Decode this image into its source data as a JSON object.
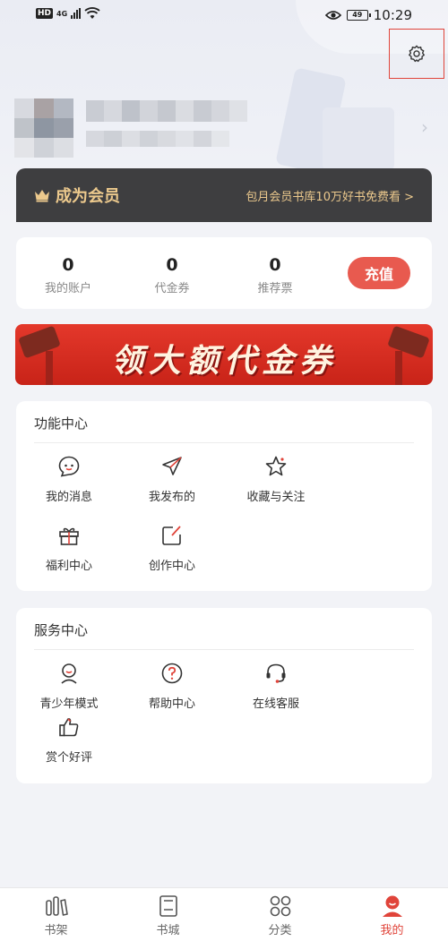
{
  "status_bar": {
    "hd": "HD",
    "network": "4G",
    "battery": "49",
    "time": "10:29"
  },
  "vip": {
    "title": "成为会员",
    "promo": "包月会员书库10万好书免费看 >"
  },
  "account": {
    "stats": [
      {
        "value": "0",
        "label": "我的账户"
      },
      {
        "value": "0",
        "label": "代金券"
      },
      {
        "value": "0",
        "label": "推荐票"
      }
    ],
    "recharge_label": "充值"
  },
  "banner": {
    "text": "领大额代金券"
  },
  "function_center": {
    "title": "功能中心",
    "items": [
      {
        "label": "我的消息",
        "icon": "chat-bubble-icon"
      },
      {
        "label": "我发布的",
        "icon": "paper-plane-icon"
      },
      {
        "label": "收藏与关注",
        "icon": "star-icon"
      },
      {
        "label": "福利中心",
        "icon": "gift-icon"
      },
      {
        "label": "创作中心",
        "icon": "edit-icon"
      }
    ]
  },
  "service_center": {
    "title": "服务中心",
    "items": [
      {
        "label": "青少年模式",
        "icon": "youth-mode-icon"
      },
      {
        "label": "帮助中心",
        "icon": "help-icon"
      },
      {
        "label": "在线客服",
        "icon": "headset-icon"
      },
      {
        "label": "赏个好评",
        "icon": "thumbs-up-icon"
      }
    ]
  },
  "bottom_nav": [
    {
      "label": "书架",
      "icon": "bookshelf-icon",
      "active": false
    },
    {
      "label": "书城",
      "icon": "bookstore-icon",
      "active": false
    },
    {
      "label": "分类",
      "icon": "category-icon",
      "active": false
    },
    {
      "label": "我的",
      "icon": "profile-icon",
      "active": true
    }
  ],
  "colors": {
    "accent": "#e0443a",
    "vip_bg": "#3e3e40",
    "vip_text": "#ecc98d",
    "page_bg": "#f2f3f7"
  }
}
